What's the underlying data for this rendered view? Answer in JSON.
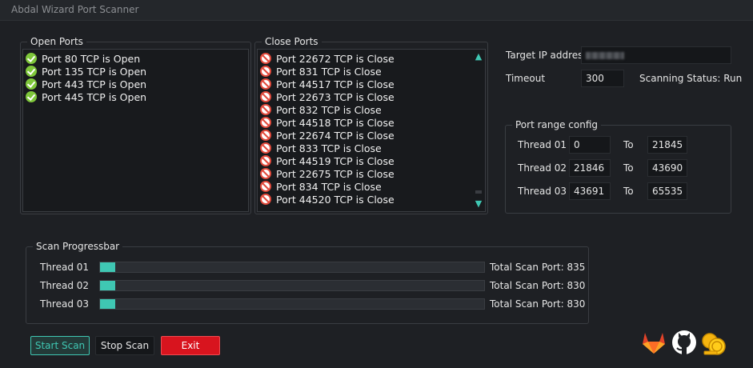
{
  "window": {
    "title": "Abdal Wizard Port Scanner"
  },
  "open_ports": {
    "title": "Open Ports",
    "items": [
      "Port 80 TCP is Open",
      "Port 135 TCP is Open",
      "Port 443 TCP is Open",
      "Port 445 TCP is Open"
    ]
  },
  "close_ports": {
    "title": "Close Ports",
    "items": [
      "Port 22672 TCP is Close",
      "Port 831 TCP is Close",
      "Port 44517 TCP is Close",
      "Port 22673 TCP is Close",
      "Port 832 TCP is Close",
      "Port 44518 TCP is Close",
      "Port 22674 TCP is Close",
      "Port 833 TCP is Close",
      "Port 44519 TCP is Close",
      "Port 22675 TCP is Close",
      "Port 834 TCP is Close",
      "Port 44520 TCP is Close"
    ]
  },
  "settings": {
    "target_ip_label": "Target IP address",
    "timeout_label": "Timeout",
    "timeout_value": "300",
    "status_text": "Scanning Status: Run"
  },
  "port_range": {
    "title": "Port range config",
    "to_label": "To",
    "threads": [
      {
        "label": "Thread 01",
        "from": "0",
        "to": "21845"
      },
      {
        "label": "Thread 02",
        "from": "21846",
        "to": "43690"
      },
      {
        "label": "Thread 03",
        "from": "43691",
        "to": "65535"
      }
    ]
  },
  "progress": {
    "title": "Scan Progressbar",
    "threads": [
      {
        "label": "Thread 01",
        "percent": 4,
        "total": "Total Scan Port: 835"
      },
      {
        "label": "Thread 02",
        "percent": 4,
        "total": "Total Scan Port: 830"
      },
      {
        "label": "Thread 03",
        "percent": 4,
        "total": "Total Scan Port: 830"
      }
    ]
  },
  "buttons": {
    "start": "Start Scan",
    "stop": "Stop Scan",
    "exit": "Exit"
  },
  "icons": [
    "gitlab-icon",
    "github-icon",
    "coins-icon"
  ],
  "colors": {
    "accent": "#3fc7b3",
    "exit": "#d8141e",
    "open": "#7ec63a",
    "close": "#e24a3c"
  }
}
